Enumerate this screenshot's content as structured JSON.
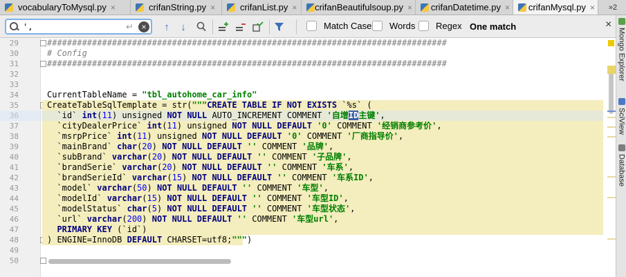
{
  "tabs": [
    {
      "label": "vocabularyToMysql.py",
      "close": "×"
    },
    {
      "label": "crifanString.py",
      "close": "×"
    },
    {
      "label": "crifanList.py",
      "close": "×"
    },
    {
      "label": "crifanBeautifulsoup.py",
      "close": "×"
    },
    {
      "label": "crifanDatetime.py",
      "close": "×"
    },
    {
      "label": "crifanMysql.py",
      "close": "×"
    }
  ],
  "tabs_overflow": "»2",
  "search": {
    "value": "',",
    "enter_symbol": "↵",
    "clear_symbol": "×",
    "options": [
      {
        "label": "Match Case"
      },
      {
        "label": "Words"
      },
      {
        "label": "Regex"
      }
    ],
    "match_count": "One match",
    "close_symbol": "×"
  },
  "tool_windows": [
    "Mongo Explorer",
    "SciView",
    "Database"
  ],
  "line_numbers": [
    "29",
    "30",
    "31",
    "32",
    "33",
    "34",
    "35",
    "36",
    "37",
    "38",
    "39",
    "40",
    "41",
    "42",
    "43",
    "44",
    "45",
    "46",
    "47",
    "48",
    "49",
    "50"
  ],
  "code": {
    "l29": "################################################################################",
    "l30": "# Config",
    "l31": "################################################################################",
    "l34_a": "CurrentTableName = ",
    "l34_b": "\"tbl_autohome_car_info\"",
    "l35_a": "CreateTableSqlTemplate = str(",
    "l35_b": "\"\"\"",
    "l35_c": "CREATE TABLE IF NOT EXISTS ",
    "l35_d": "`%s` (",
    "l36_a": "  `id` ",
    "l36_b": "int",
    "l36_c": "(",
    "l36_d": "11",
    "l36_e": ") unsigned ",
    "l36_f": "NOT NULL",
    "l36_g": " AUTO_INCREMENT COMMENT ",
    "l36_h": "'自增",
    "l36_i": "ID",
    "l36_j": "主键'",
    "l36_k": ",",
    "l37_a": "  `cityDealerPrice` ",
    "l37_b": "int",
    "l37_c": "(",
    "l37_d": "11",
    "l37_e": ") unsigned ",
    "l37_f": "NOT NULL DEFAULT",
    "l37_g": " ",
    "l37_h": "'0'",
    "l37_i": " COMMENT ",
    "l37_j": "'经销商参考价'",
    "l37_k": ",",
    "l38_a": "  `msrpPrice` ",
    "l38_b": "int",
    "l38_c": "(",
    "l38_d": "11",
    "l38_e": ") unsigned ",
    "l38_f": "NOT NULL DEFAULT",
    "l38_g": " ",
    "l38_h": "'0'",
    "l38_i": " COMMENT ",
    "l38_j": "'厂商指导价'",
    "l38_k": ",",
    "cols": [
      {
        "name": "  `mainBrand` ",
        "type": "char",
        "len": "20",
        "comment": "'品牌'"
      },
      {
        "name": "  `subBrand` ",
        "type": "varchar",
        "len": "20",
        "comment": "'子品牌'"
      },
      {
        "name": "  `brandSerie` ",
        "type": "varchar",
        "len": "20",
        "comment": "'车系'"
      },
      {
        "name": "  `brandSerieId` ",
        "type": "varchar",
        "len": "15",
        "comment": "'车系ID'"
      },
      {
        "name": "  `model` ",
        "type": "varchar",
        "len": "50",
        "comment": "'车型'"
      },
      {
        "name": "  `modelId` ",
        "type": "varchar",
        "len": "15",
        "comment": "'车型ID'"
      },
      {
        "name": "  `modelStatus` ",
        "type": "char",
        "len": "5",
        "comment": "'车型状态'"
      },
      {
        "name": "  `url` ",
        "type": "varchar",
        "len": "200",
        "comment": "'车型url'"
      }
    ],
    "col_paren_open": "(",
    "col_paren_close": ") ",
    "col_notnull": "NOT NULL DEFAULT",
    "col_empty": " '' ",
    "col_comment": "COMMENT ",
    "col_comma": ",",
    "l47_a": "  PRIMARY KEY ",
    "l47_b": "(`id`)",
    "l48_a": ") ENGINE=InnoDB ",
    "l48_b": "DEFAULT",
    "l48_c": " CHARSET=utf8;",
    "l48_d": "\"\"\"",
    "l48_e": ")"
  },
  "colors": {
    "keyword": "#000080",
    "string": "#008000",
    "number": "#0000ff",
    "comment": "#808080",
    "highlight": "#f4edbd"
  }
}
